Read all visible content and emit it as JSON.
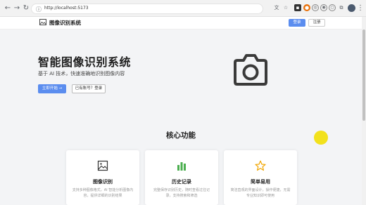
{
  "browser": {
    "url": "http://localhost:5173",
    "back_icon": "arrow-left-icon",
    "forward_icon": "arrow-right-icon",
    "reload_icon": "reload-icon"
  },
  "header": {
    "title": "图像识别系统",
    "login_label": "登录",
    "register_label": "注册"
  },
  "hero": {
    "title": "智能图像识别系统",
    "subtitle": "基于 AI 技术，快速准确地识别图像内容",
    "start_label": "立即开始 →",
    "account_label": "已有账号？登录"
  },
  "features": {
    "section_title": "核心功能",
    "cards": [
      {
        "icon": "image-icon",
        "title": "图像识别",
        "desc": "支持多种图像格式，AI 智能分析图像内容，提供详细的识别结果"
      },
      {
        "icon": "bar-chart-icon",
        "title": "历史记录",
        "desc": "完整保存识别历史，随时查看过往记录，支持搜索和筛选"
      },
      {
        "icon": "star-icon",
        "title": "简单易用",
        "desc": "简洁直观的界面设计，操作便捷，无需专业知识即可使用"
      }
    ]
  },
  "colors": {
    "accent": "#5b8def",
    "background": "#f3f4f6"
  }
}
